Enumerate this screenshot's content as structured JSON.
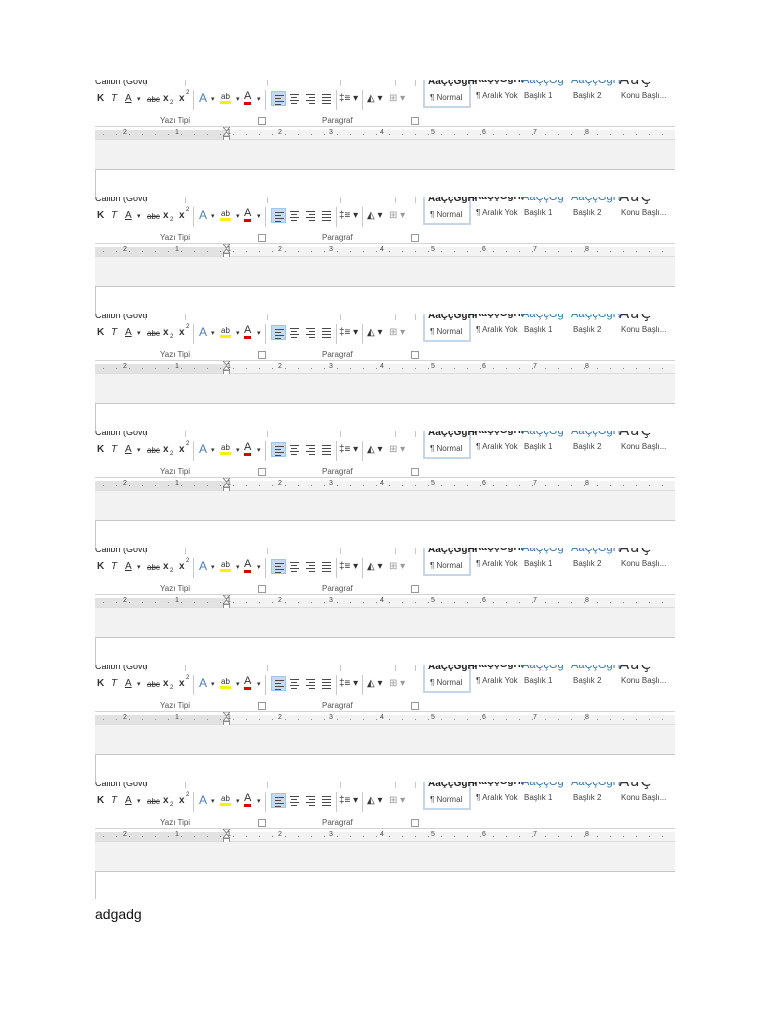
{
  "ribbon": {
    "font_name_fragment": "Calibri (Gövd",
    "font_buttons": {
      "bold": "K",
      "italic": "T",
      "underline": "A",
      "strikethrough": "abc",
      "subscript": "x",
      "superscript": "x",
      "text_effects": "A",
      "highlight": "ab",
      "font_color": "A"
    },
    "group_labels": {
      "font": "Yazı Tipi",
      "paragraph": "Paragraf"
    },
    "styles": [
      {
        "preview": "AaÇçĞğHı",
        "name": "¶ Normal",
        "kind": "normal",
        "selected": true
      },
      {
        "preview": "AaÇçĞğHı",
        "name": "¶ Aralık Yok",
        "kind": "normal",
        "selected": false
      },
      {
        "preview": "AaÇçĞğ",
        "name": "Başlık 1",
        "kind": "heading",
        "selected": false
      },
      {
        "preview": "AaÇçĞğH",
        "name": "Başlık 2",
        "kind": "heading",
        "selected": false
      },
      {
        "preview": "AaÇ",
        "name": "Konu Başlı...",
        "kind": "title",
        "selected": false
      }
    ],
    "ruler_numbers": [
      "2",
      "1",
      "1",
      "2",
      "3",
      "4",
      "5",
      "6",
      "7",
      "8"
    ]
  },
  "document": {
    "text": "adgadg"
  },
  "colors": {
    "highlight_yellow": "#ffef00",
    "font_color_red": "#e00000",
    "heading_blue": "#2f75b5",
    "selected_fill": "#c5d9f1"
  }
}
